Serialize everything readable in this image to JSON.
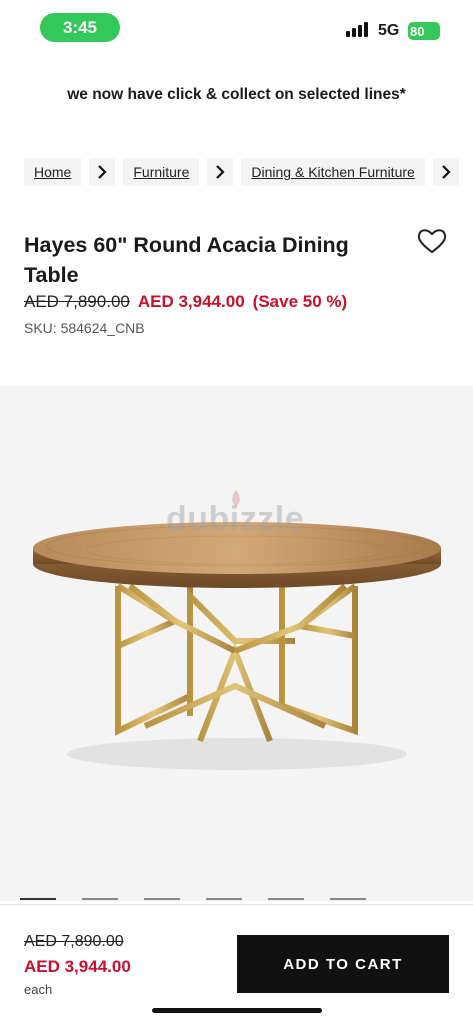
{
  "status_bar": {
    "time": "3:45",
    "network": "5G",
    "battery": "80"
  },
  "announcement": "we now have click & collect on selected lines*",
  "breadcrumb": {
    "items": [
      "Home",
      "Furniture",
      "Dining & Kitchen Furniture"
    ]
  },
  "product": {
    "title": "Hayes 60\" Round Acacia Dining Table",
    "old_price": "AED 7,890.00",
    "new_price": "AED 3,944.00",
    "save": "(Save 50 %)",
    "sku": "SKU: 584624_CNB"
  },
  "image": {
    "watermark": "dubizzle"
  },
  "bottom_bar": {
    "old_price": "AED 7,890.00",
    "new_price": "AED 3,944.00",
    "unit": "each",
    "add_to_cart": "ADD TO CART"
  },
  "colors": {
    "sale_red": "#c8102e",
    "status_green": "#34c759",
    "button_black": "#111111"
  }
}
